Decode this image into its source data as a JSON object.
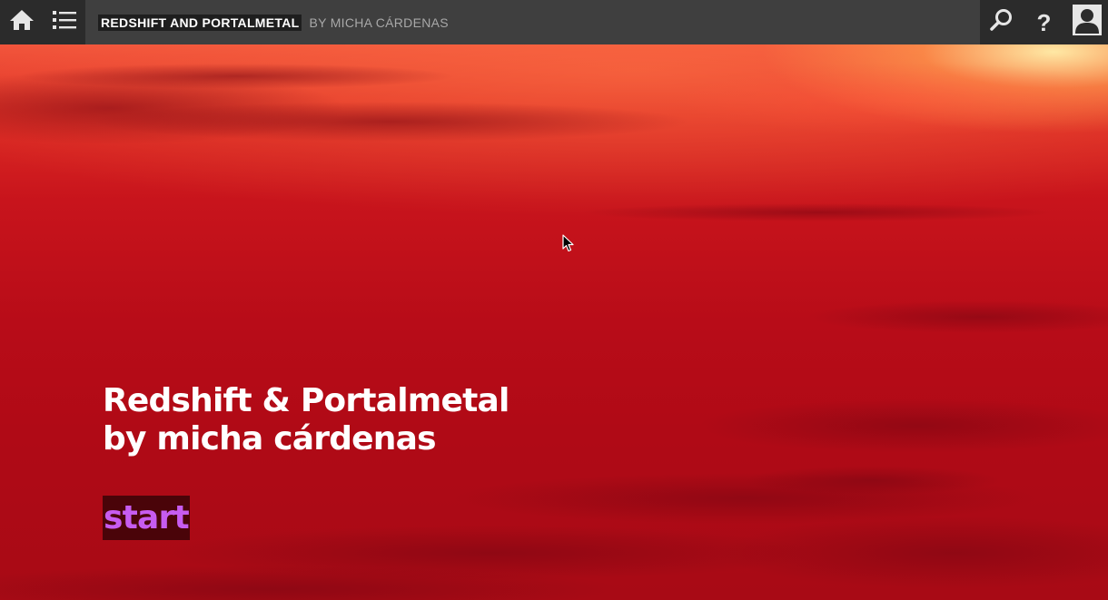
{
  "topbar": {
    "book_title": "REDSHIFT AND PORTALMETAL",
    "book_author": "BY MICHA CÁRDENAS",
    "help_label": "?"
  },
  "icons": {
    "home": "home-icon",
    "contents": "list-icon",
    "search": "search-icon",
    "help": "help-icon",
    "account": "user-icon"
  },
  "hero": {
    "title_line1": "Redshift & Portalmetal",
    "title_line2": "by micha cárdenas",
    "start_label": "start"
  },
  "colors": {
    "topbar": "#3f3f3f",
    "topbar_buttons": "#2b2b2b",
    "start_text": "#c75cf0",
    "start_bg": "#4a0409",
    "hero_red": "#b80c18"
  }
}
